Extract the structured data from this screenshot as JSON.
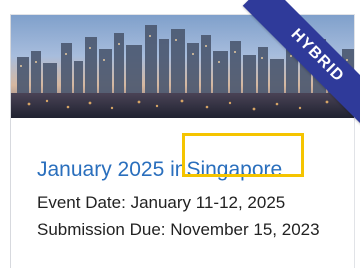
{
  "card": {
    "badge": "HYBRID",
    "title_prefix": "January 2025 in",
    "title_location": "Singapore",
    "event_date_label": "Event Date:",
    "event_date_value": "January 11-12, 2025",
    "submission_label": "Submission Due:",
    "submission_value": "November 15, 2023"
  },
  "colors": {
    "title": "#2a6fbd",
    "badge": "#2f3a9a",
    "highlight": "#f5c400"
  }
}
